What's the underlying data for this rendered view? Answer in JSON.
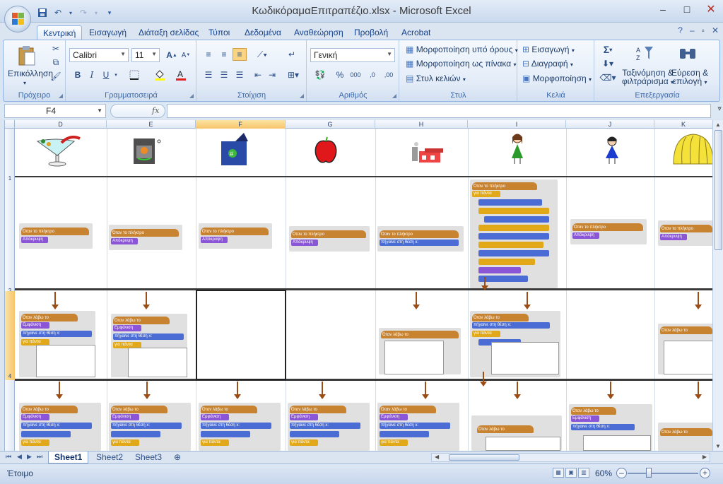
{
  "window": {
    "title": "ΚωδικόραμαΕπιτραπέζιο.xlsx - Microsoft Excel",
    "minimize": "–",
    "maximize": "□",
    "close": "✕"
  },
  "qat": {
    "save_icon": "save-icon",
    "undo_icon": "undo-icon",
    "redo_icon": "redo-icon",
    "customize": "▾"
  },
  "tabs": [
    "Κεντρική",
    "Εισαγωγή",
    "Διάταξη σελίδας",
    "Τύποι",
    "Δεδομένα",
    "Αναθεώρηση",
    "Προβολή",
    "Acrobat"
  ],
  "active_tab": "Κεντρική",
  "ribbon": {
    "clipboard": {
      "label": "Πρόχειρο",
      "paste": "Επικόλληση"
    },
    "font": {
      "label": "Γραμματοσειρά",
      "name": "Calibri",
      "size": "11",
      "bold": "B",
      "italic": "I",
      "underline": "U",
      "grow": "A",
      "shrink": "A"
    },
    "alignment": {
      "label": "Στοίχιση"
    },
    "number": {
      "label": "Αριθμός",
      "format": "Γενική",
      "percent": "%",
      "thousands": "000",
      "inc_dec": ",0",
      "dec_dec": ",00"
    },
    "styles": {
      "label": "Στυλ",
      "conditional": "Μορφοποίηση υπό όρους",
      "as_table": "Μορφοποίηση ως πίνακα",
      "cell_styles": "Στυλ κελιών"
    },
    "cells": {
      "label": "Κελιά",
      "insert": "Εισαγωγή",
      "delete": "Διαγραφή",
      "format": "Μορφοποίηση"
    },
    "editing": {
      "label": "Επεξεργασία",
      "sum": "Σ",
      "sort_1": "Ταξινόμηση &",
      "sort_2": "φιλτράρισμα",
      "find_1": "Εύρεση &",
      "find_2": "επιλογή"
    }
  },
  "formula_bar": {
    "name_box": "F4",
    "fx": "fx",
    "formula": ""
  },
  "grid": {
    "columns": [
      "D",
      "E",
      "F",
      "G",
      "H",
      "I",
      "J",
      "K"
    ],
    "selected_column": "F",
    "rows": [
      "1",
      "3",
      "4"
    ],
    "selected_row": "4",
    "selected_cell": "F4",
    "script_texts": {
      "when_key": "Όταν το πλήκτρο",
      "hide": "Απόκρυψη",
      "when_receive": "Όταν λάβω το",
      "show": "Εμφάνιση",
      "goto": "πήγαινε στη θέση x:",
      "forever": "για πάντα"
    }
  },
  "sheets": [
    "Sheet1",
    "Sheet2",
    "Sheet3"
  ],
  "active_sheet": "Sheet1",
  "status": {
    "text": "Έτοιμο",
    "zoom": "60%"
  },
  "colors": {
    "accent": "#15428b",
    "hat": "#c88330",
    "purple": "#8a55d7",
    "arrow": "#9a4d16"
  }
}
